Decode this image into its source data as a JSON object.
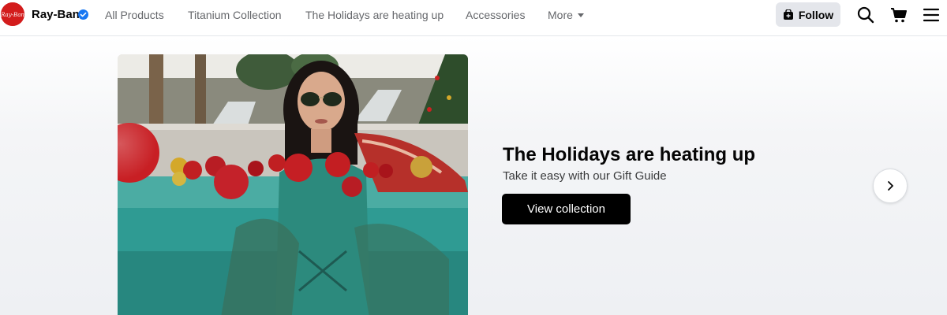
{
  "brand": {
    "name": "Ray-Ban",
    "logo_text": "Ray-Ban",
    "logo_color": "#d31c1c",
    "verified_color": "#1877f2"
  },
  "nav": {
    "links": [
      "All Products",
      "Titanium Collection",
      "The Holidays are heating up",
      "Accessories"
    ],
    "more_label": "More"
  },
  "actions": {
    "follow_label": "Follow",
    "icons": [
      "search-icon",
      "cart-icon",
      "menu-icon"
    ]
  },
  "hero": {
    "title": "The Holidays are heating up",
    "subtitle": "Take it easy with our Gift Guide",
    "cta_label": "View collection",
    "cta_color": "#000000",
    "image_description_icon": "pool-photo"
  }
}
